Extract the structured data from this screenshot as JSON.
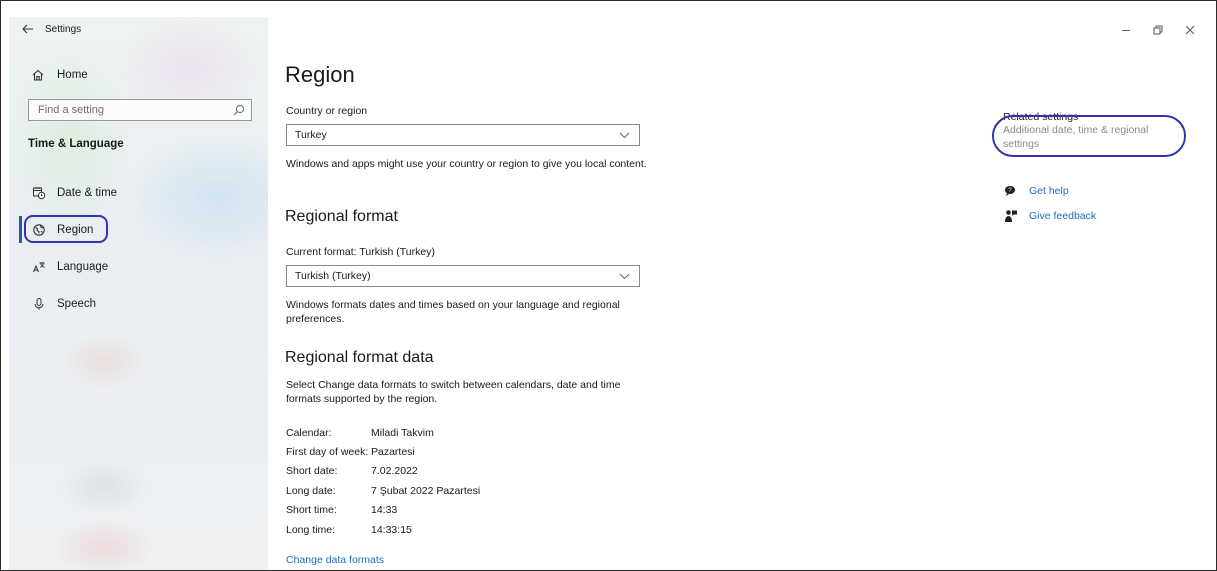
{
  "window": {
    "app_title": "Settings"
  },
  "sidebar": {
    "home_label": "Home",
    "search_placeholder": "Find a setting",
    "section_header": "Time & Language",
    "items": [
      {
        "label": "Date & time",
        "icon": "calendar-clock-icon"
      },
      {
        "label": "Region",
        "icon": "globe-icon",
        "selected": true
      },
      {
        "label": "Language",
        "icon": "language-icon"
      },
      {
        "label": "Speech",
        "icon": "microphone-icon"
      }
    ]
  },
  "main": {
    "title": "Region",
    "country": {
      "label": "Country or region",
      "value": "Turkey",
      "description": "Windows and apps might use your country or region to give you local content."
    },
    "regional_format": {
      "heading": "Regional format",
      "current_label": "Current format: Turkish (Turkey)",
      "value": "Turkish (Turkey)",
      "description": "Windows formats dates and times based on your language and regional preferences."
    },
    "format_data": {
      "heading": "Regional format data",
      "description": "Select Change data formats to switch between calendars, date and time formats supported by the region.",
      "rows": [
        {
          "key": "Calendar:",
          "value": "Miladi Takvim"
        },
        {
          "key": "First day of week:",
          "value": "Pazartesi"
        },
        {
          "key": "Short date:",
          "value": "7.02.2022"
        },
        {
          "key": "Long date:",
          "value": "7 Şubat 2022 Pazartesi"
        },
        {
          "key": "Short time:",
          "value": "14:33"
        },
        {
          "key": "Long time:",
          "value": "14:33:15"
        }
      ],
      "change_link": "Change data formats"
    }
  },
  "related": {
    "title": "Related settings",
    "link": "Additional date, time & regional settings",
    "get_help": "Get help",
    "give_feedback": "Give feedback"
  },
  "colors": {
    "accent": "#1f6bbd",
    "annotation": "#3534b0"
  }
}
